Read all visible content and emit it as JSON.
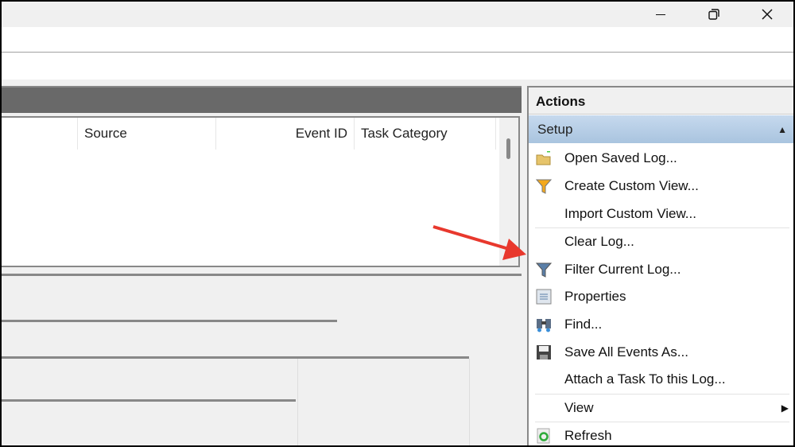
{
  "window": {
    "restore_icon": "restore-icon",
    "close_icon": "close-icon"
  },
  "grid": {
    "columns": [
      "Source",
      "Event ID",
      "Task Category"
    ]
  },
  "actions": {
    "title": "Actions",
    "section": "Setup",
    "items": [
      "Open Saved Log...",
      "Create Custom View...",
      "Import Custom View...",
      "Clear Log...",
      "Filter Current Log...",
      "Properties",
      "Find...",
      "Save All Events As...",
      "Attach a Task To this Log...",
      "View",
      "Refresh"
    ]
  },
  "annotation": {
    "arrow_color": "#e8382d"
  }
}
